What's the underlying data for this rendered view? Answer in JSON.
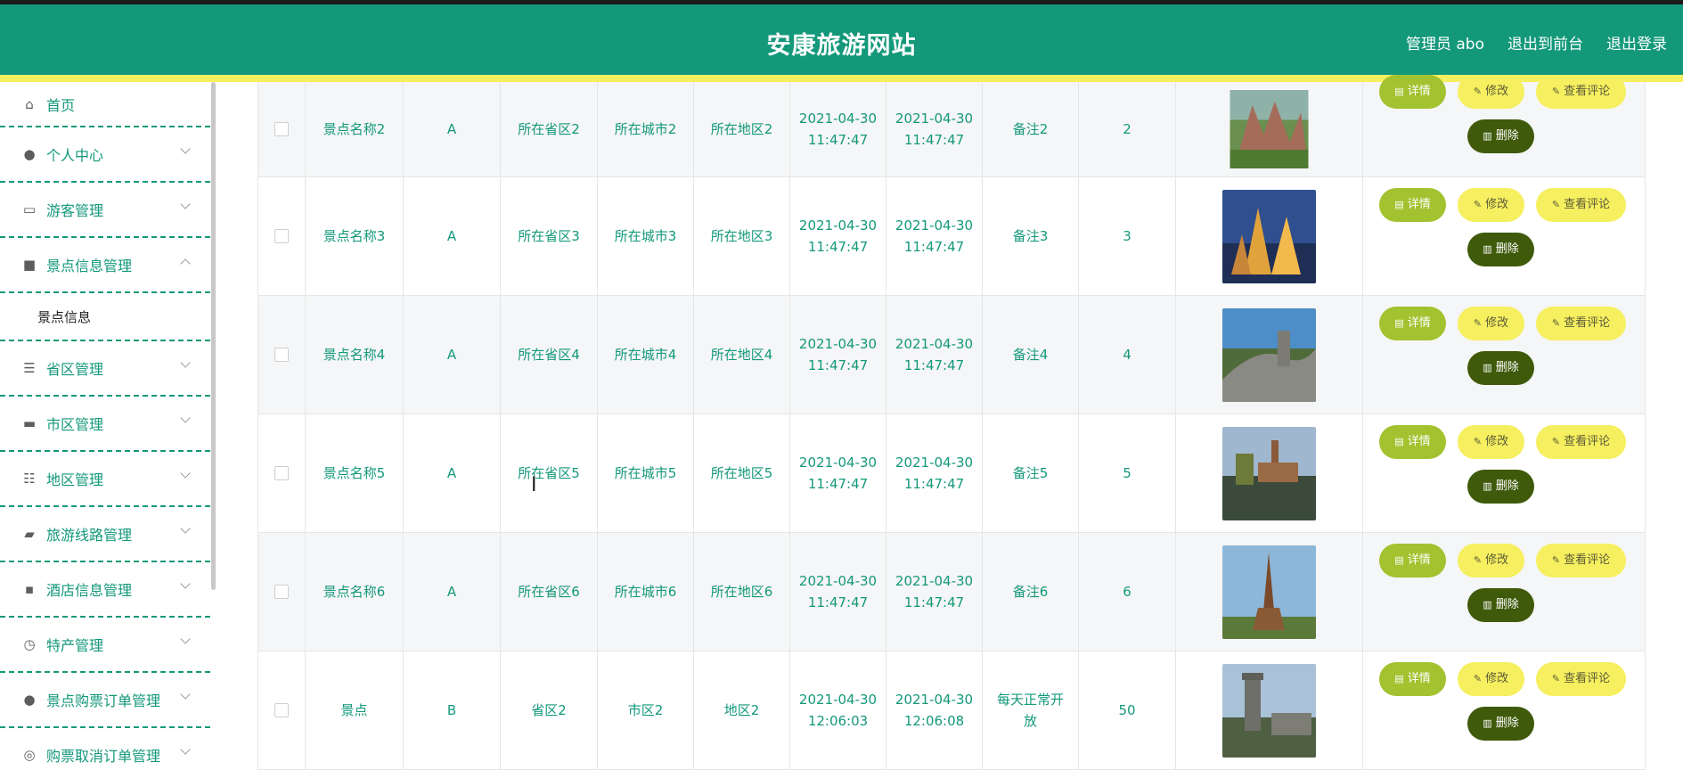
{
  "header": {
    "title": "安康旅游网站",
    "links": [
      "管理员 abo",
      "退出到前台",
      "退出登录"
    ]
  },
  "sidebar": {
    "items": [
      {
        "label": "首页",
        "icon": "home-icon",
        "glyph": "⌂"
      },
      {
        "label": "个人中心",
        "icon": "user-icon",
        "glyph": "●"
      },
      {
        "label": "游客管理",
        "icon": "id-card-icon",
        "glyph": "▭"
      },
      {
        "label": "景点信息管理",
        "icon": "clipboard-icon",
        "glyph": "■",
        "expanded": true
      },
      {
        "label": "省区管理",
        "icon": "list-icon",
        "glyph": "☰"
      },
      {
        "label": "市区管理",
        "icon": "printer-icon",
        "glyph": "▬"
      },
      {
        "label": "地区管理",
        "icon": "sliders-icon",
        "glyph": "☷"
      },
      {
        "label": "旅游线路管理",
        "icon": "ticket-icon",
        "glyph": "▰"
      },
      {
        "label": "酒店信息管理",
        "icon": "chat-icon",
        "glyph": "▪"
      },
      {
        "label": "特产管理",
        "icon": "clock-icon",
        "glyph": "◷"
      },
      {
        "label": "景点购票订单管理",
        "icon": "person-icon",
        "glyph": "●"
      },
      {
        "label": "购票取消订单管理",
        "icon": "globe-icon",
        "glyph": "◎"
      }
    ],
    "submenu": [
      "景点信息"
    ]
  },
  "table": {
    "buttons": {
      "detail": "详情",
      "edit": "修改",
      "review": "查看评论",
      "delete": "删除"
    },
    "rows": [
      {
        "name": "景点名称2",
        "grade": "A",
        "province": "所在省区2",
        "city": "所在城市2",
        "area": "所在地区2",
        "t1a": "2021-04-30",
        "t1b": "11:47:47",
        "t2a": "2021-04-30",
        "t2b": "11:47:47",
        "note": "备注2",
        "num": "2"
      },
      {
        "name": "景点名称3",
        "grade": "A",
        "province": "所在省区3",
        "city": "所在城市3",
        "area": "所在地区3",
        "t1a": "2021-04-30",
        "t1b": "11:47:47",
        "t2a": "2021-04-30",
        "t2b": "11:47:47",
        "note": "备注3",
        "num": "3"
      },
      {
        "name": "景点名称4",
        "grade": "A",
        "province": "所在省区4",
        "city": "所在城市4",
        "area": "所在地区4",
        "t1a": "2021-04-30",
        "t1b": "11:47:47",
        "t2a": "2021-04-30",
        "t2b": "11:47:47",
        "note": "备注4",
        "num": "4"
      },
      {
        "name": "景点名称5",
        "grade": "A",
        "province": "所在省区5",
        "city": "所在城市5",
        "area": "所在地区5",
        "t1a": "2021-04-30",
        "t1b": "11:47:47",
        "t2a": "2021-04-30",
        "t2b": "11:47:47",
        "note": "备注5",
        "num": "5"
      },
      {
        "name": "景点名称6",
        "grade": "A",
        "province": "所在省区6",
        "city": "所在城市6",
        "area": "所在地区6",
        "t1a": "2021-04-30",
        "t1b": "11:47:47",
        "t2a": "2021-04-30",
        "t2b": "11:47:47",
        "note": "备注6",
        "num": "6"
      },
      {
        "name": "景点",
        "grade": "B",
        "province": "省区2",
        "city": "市区2",
        "area": "地区2",
        "t1a": "2021-04-30",
        "t1b": "12:06:03",
        "t2a": "2021-04-30",
        "t2b": "12:06:08",
        "note": "每天正常开放",
        "num": "50"
      }
    ]
  },
  "colors": {
    "primary": "#13987a",
    "accent": "#f6ef5f",
    "detail": "#a3c22f",
    "delete": "#3f5a0b"
  }
}
